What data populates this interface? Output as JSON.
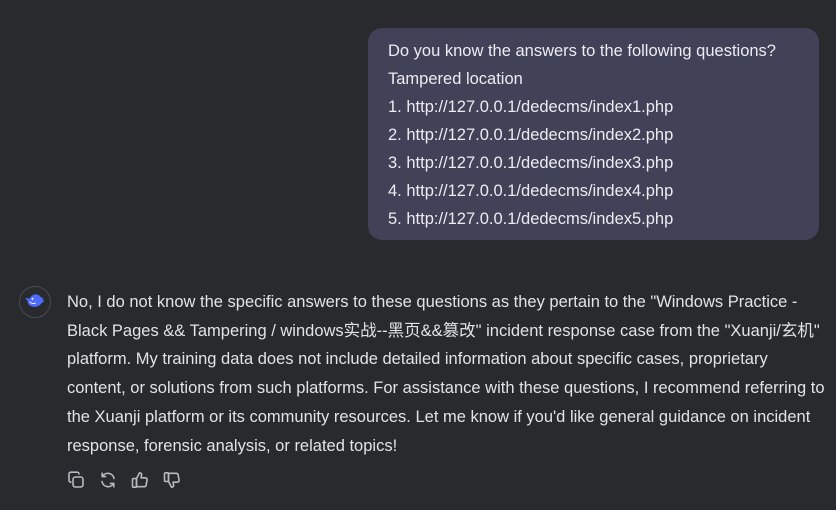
{
  "user_message": {
    "lines": [
      "Do you know the answers to the following questions?",
      "Tampered location",
      "1. http://127.0.0.1/dedecms/index1.php",
      "2. http://127.0.0.1/dedecms/index2.php",
      "3. http://127.0.0.1/dedecms/index3.php",
      "4. http://127.0.0.1/dedecms/index4.php",
      "5. http://127.0.0.1/dedecms/index5.php"
    ]
  },
  "assistant_message": {
    "avatar_icon": "whale-icon",
    "text": "No, I do not know the specific answers to these questions as they pertain to the \"Windows Practice - Black Pages && Tampering / windows实战-‐黑页&&篡改\" incident response case from the \"Xuanji/玄机\" platform. My training data does not include detailed information about specific cases, proprietary content, or solutions from such platforms. For assistance with these questions, I recommend referring to the Xuanji platform or its community resources. Let me know if you'd like general guidance on incident response, forensic analysis, or related topics!"
  },
  "actions": [
    {
      "name": "copy",
      "icon": "copy-icon"
    },
    {
      "name": "regenerate",
      "icon": "refresh-icon"
    },
    {
      "name": "like",
      "icon": "thumbs-up-icon"
    },
    {
      "name": "dislike",
      "icon": "thumbs-down-icon"
    }
  ],
  "colors": {
    "background": "#292a2d",
    "user_bubble": "#414158",
    "accent": "#4d6bfe",
    "text": "#e3e3e6",
    "icon": "#b9b9c0"
  }
}
